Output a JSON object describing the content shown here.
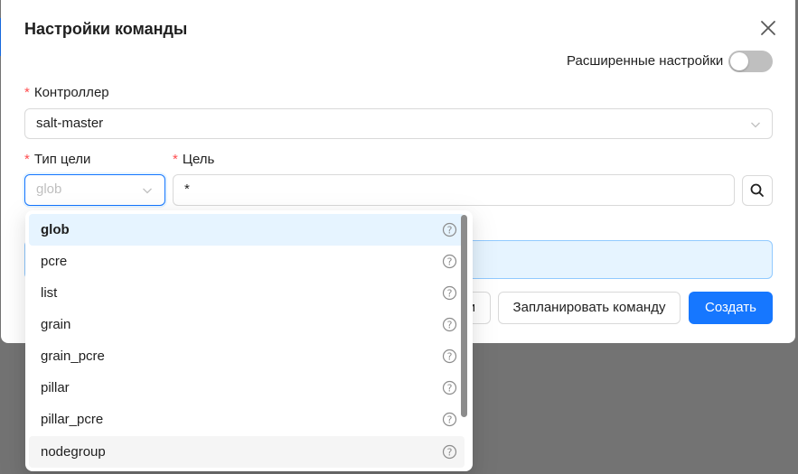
{
  "modal": {
    "title": "Настройки команды",
    "close_icon": "close-icon",
    "advanced_settings_label": "Расширенные настройки",
    "advanced_settings_enabled": false
  },
  "form": {
    "controller": {
      "required_mark": "*",
      "label": "Контроллер",
      "value": "salt-master",
      "icon": "chevron-down-icon"
    },
    "target_type": {
      "required_mark": "*",
      "label": "Тип цели",
      "placeholder": "glob",
      "icon": "chevron-down-icon"
    },
    "target": {
      "required_mark": "*",
      "label": "Цель",
      "value": "*",
      "search_icon": "search-icon"
    }
  },
  "buttons": {
    "hidden_partial_label": "и",
    "schedule_label": "Запланировать команду",
    "create_label": "Создать"
  },
  "dropdown": {
    "options": [
      {
        "label": "glob",
        "help_icon": "question-circle-icon",
        "state": "selected"
      },
      {
        "label": "pcre",
        "help_icon": "question-circle-icon"
      },
      {
        "label": "list",
        "help_icon": "question-circle-icon"
      },
      {
        "label": "grain",
        "help_icon": "question-circle-icon"
      },
      {
        "label": "grain_pcre",
        "help_icon": "question-circle-icon"
      },
      {
        "label": "pillar",
        "help_icon": "question-circle-icon"
      },
      {
        "label": "pillar_pcre",
        "help_icon": "question-circle-icon"
      },
      {
        "label": "nodegroup",
        "help_icon": "question-circle-icon",
        "state": "hover"
      }
    ]
  },
  "colors": {
    "primary": "#1677ff",
    "required": "#ff4d4f",
    "selected_option_bg": "#e6f4ff",
    "overlay": "#737373"
  }
}
